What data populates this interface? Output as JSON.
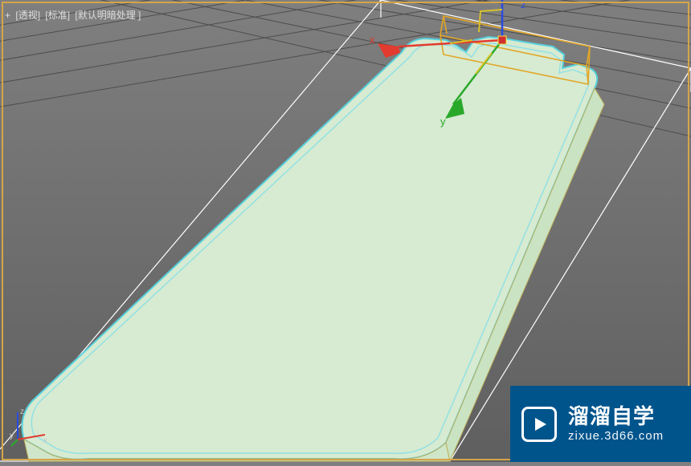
{
  "viewport": {
    "border_color": "#d4a54a",
    "labels": {
      "menu": "+",
      "view": "[透视]",
      "standard": "[标准]",
      "shading": "[默认明暗处理 ]"
    }
  },
  "gizmo": {
    "x_color": "#e33b2f",
    "y_color": "#2aa82a",
    "z_color": "#2a4ae0",
    "x_label": "x",
    "y_label": "y",
    "z_label": "z"
  },
  "mini_axis": {
    "x_label": "x",
    "y_label": "y",
    "z_label": "z"
  },
  "object": {
    "fill_color": "#d6ebd1",
    "edge_color": "#58d0dc",
    "outline_dark": "#2a566a",
    "selection_box": "#e0e0e0",
    "pivot_box": "#e2a627"
  },
  "watermark": {
    "title": "溜溜自学",
    "sub": "zixue.3d66.com",
    "bg": "#00548c",
    "icon_name": "play-icon"
  }
}
